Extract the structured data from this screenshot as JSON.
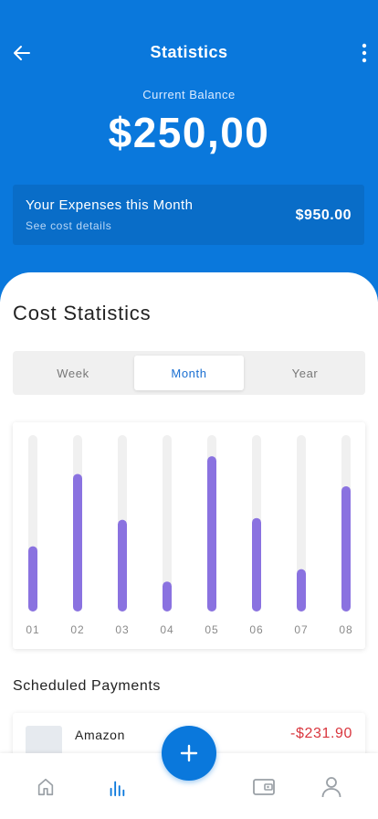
{
  "header": {
    "title": "Statistics",
    "balance_label": "Current Balance",
    "balance_value": "$250,00",
    "back_icon": "arrow-left-icon",
    "more_icon": "more-vertical-icon"
  },
  "expenses_card": {
    "title": "Your Expenses this Month",
    "subtitle": "See cost details",
    "amount": "$950.00"
  },
  "cost_statistics": {
    "title": "Cost Statistics",
    "tabs": [
      {
        "label": "Week",
        "active": false
      },
      {
        "label": "Month",
        "active": true
      },
      {
        "label": "Year",
        "active": false
      }
    ]
  },
  "chart_data": {
    "type": "bar",
    "categories": [
      "01",
      "02",
      "03",
      "04",
      "05",
      "06",
      "07",
      "08"
    ],
    "values": [
      37,
      78,
      52,
      17,
      88,
      53,
      24,
      71
    ],
    "ylim": [
      0,
      100
    ],
    "grid": false,
    "bar_color": "#8a72e0",
    "track_color": "#f0f0f0"
  },
  "scheduled_payments": {
    "title": "Scheduled Payments",
    "items": [
      {
        "name": "Amazon",
        "amount": "-$231.90"
      }
    ]
  },
  "bottom_nav": {
    "items": [
      {
        "icon": "home-icon",
        "active": false
      },
      {
        "icon": "bar-chart-icon",
        "active": true
      },
      {
        "icon": "wallet-icon",
        "active": false
      },
      {
        "icon": "user-icon",
        "active": false
      }
    ],
    "fab_icon": "plus-icon"
  },
  "colors": {
    "primary": "#0a78dc",
    "bar": "#8a72e0",
    "negative": "#d9363e",
    "inactive_icon": "#9aa0a6"
  }
}
